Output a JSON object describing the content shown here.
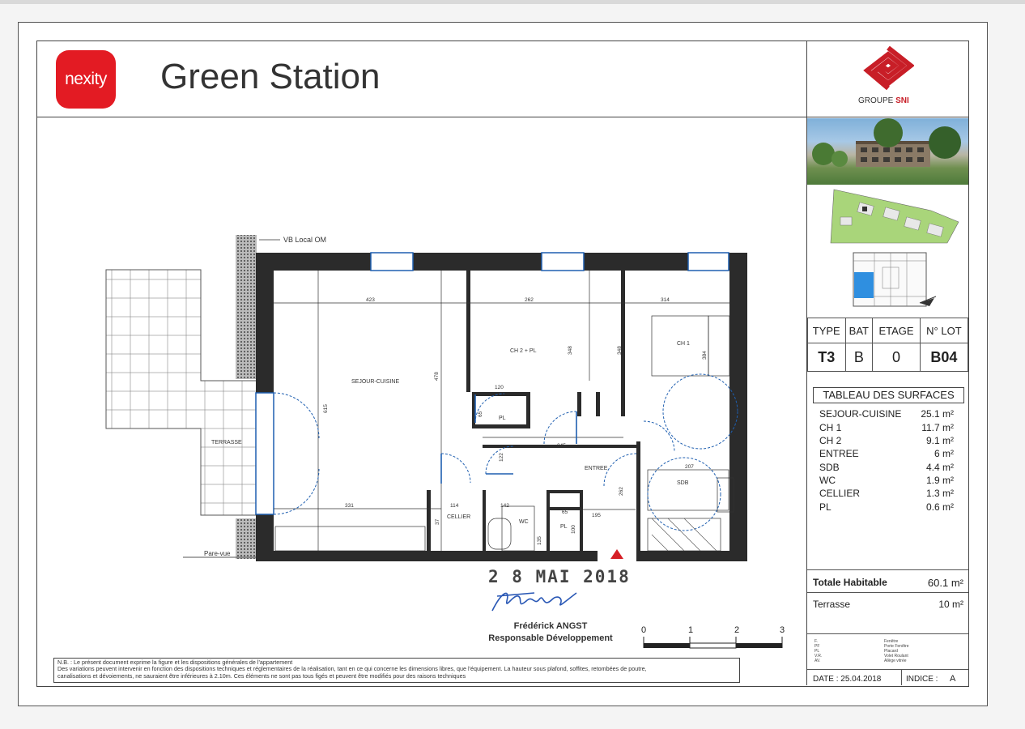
{
  "header": {
    "brand": "nexity",
    "title": "Green Station",
    "partner": "GROUPE",
    "partner_accent": "SNI"
  },
  "lot_table": {
    "headers": [
      "TYPE",
      "BAT",
      "ETAGE",
      "N° LOT"
    ],
    "values": [
      "T3",
      "B",
      "0",
      "B04"
    ]
  },
  "surfaces": {
    "title": "TABLEAU DES SURFACES",
    "rows": [
      {
        "label": "SEJOUR-CUISINE",
        "value": "25.1 m²"
      },
      {
        "label": "CH 1",
        "value": "11.7 m²"
      },
      {
        "label": "CH 2",
        "value": "9.1 m²"
      },
      {
        "label": "ENTREE",
        "value": "6 m²"
      },
      {
        "label": "SDB",
        "value": "4.4 m²"
      },
      {
        "label": "WC",
        "value": "1.9 m²"
      },
      {
        "label": "CELLIER",
        "value": "1.3 m²"
      },
      {
        "label": "PL",
        "value": "0.6 m²"
      }
    ],
    "total_label": "Totale Habitable",
    "total_value": "60.1 m²",
    "terrace_label": "Terrasse",
    "terrace_value": "10 m²"
  },
  "legend": [
    {
      "code": "F.",
      "text": "Fenêtre"
    },
    {
      "code": "PF",
      "text": "Porte Fenêtre"
    },
    {
      "code": "PL",
      "text": "Placard"
    },
    {
      "code": "V.R.",
      "text": "Volet Roulant"
    },
    {
      "code": "AV.",
      "text": "Allège vitrée"
    }
  ],
  "footer": {
    "date": "DATE : 25.04.2018",
    "indice_label": "INDICE :",
    "indice_value": "A"
  },
  "plan": {
    "rooms": {
      "sejour": "SEJOUR-CUISINE",
      "ch2": "CH 2 + PL",
      "ch1": "CH 1",
      "entree": "ENTREE",
      "sdb": "SDB",
      "wc": "WC",
      "cellier": "CELLIER",
      "terrasse": "TERRASSE",
      "pl": "PL",
      "pl2": "PL"
    },
    "labels": {
      "vb": "VB Local OM",
      "parevue": "Pare-vue"
    },
    "dimensions": [
      "423",
      "262",
      "314",
      "348",
      "348",
      "384",
      "478",
      "615",
      "120",
      "65",
      "345",
      "122",
      "207",
      "331",
      "114",
      "142",
      "65",
      "195",
      "262",
      "135",
      "37",
      "100"
    ]
  },
  "stamp": {
    "date": "2 8 MAI 2018",
    "name": "Frédérick ANGST",
    "role": "Responsable Développement"
  },
  "scale": [
    "0",
    "1",
    "2",
    "3"
  ],
  "note": {
    "line1": "N.B. : Le présent document exprime la figure et les dispositions générales de l'appartement",
    "line2": "Des variations peuvent intervenir en fonction des dispositions techniques et réglementaires de la réalisation, tant en ce qui concerne les dimensions libres, que l'équipement. La hauteur sous plafond, soffites, retombées de poutre,",
    "line3": "canalisations et dévoiements, ne sauraient être inférieures à 2.10m. Ces éléments ne sont pas tous figés et peuvent être modifiés pour des raisons techniques"
  },
  "colors": {
    "brand_red": "#e31b23",
    "sni_red": "#c81e27",
    "door_blue": "#1f5fb0",
    "keyplan_blue": "#2f8fe0"
  }
}
